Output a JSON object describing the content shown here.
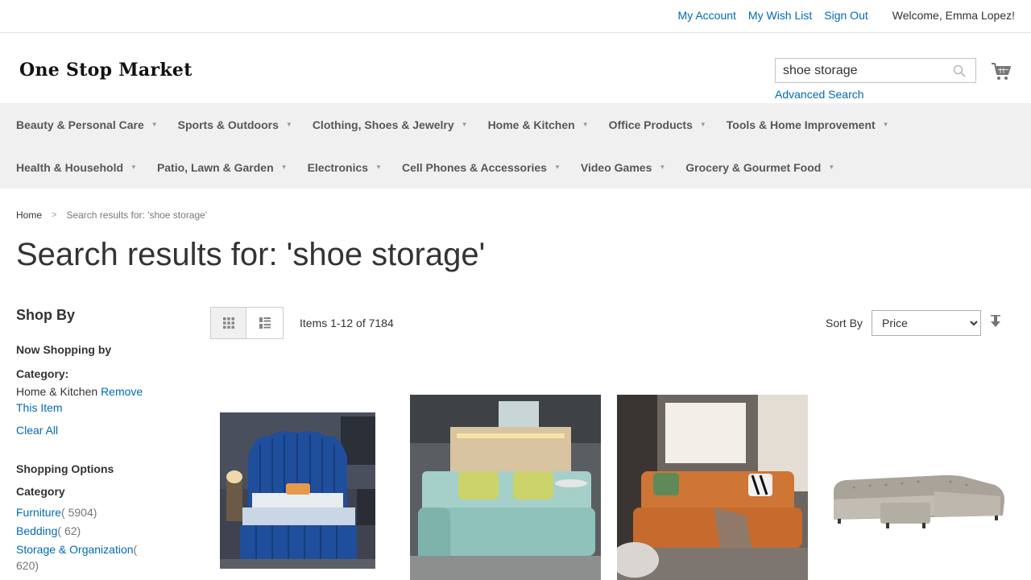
{
  "top_links": {
    "my_account": "My Account",
    "wish_list": "My Wish List",
    "sign_out": "Sign Out",
    "welcome": "Welcome, Emma Lopez!"
  },
  "header": {
    "logo_text": "One Stop Market",
    "search_value": "shoe storage",
    "advanced_search": "Advanced Search"
  },
  "nav": {
    "row1": [
      "Beauty & Personal Care",
      "Sports & Outdoors",
      "Clothing, Shoes & Jewelry",
      "Home & Kitchen",
      "Office Products",
      "Tools & Home Improvement"
    ],
    "row2": [
      "Health & Household",
      "Patio, Lawn & Garden",
      "Electronics",
      "Cell Phones & Accessories",
      "Video Games",
      "Grocery & Gourmet Food"
    ]
  },
  "breadcrumb": {
    "home": "Home",
    "current": "Search results for: 'shoe storage'"
  },
  "page_title": "Search results for: 'shoe storage'",
  "sidebar": {
    "shop_by": "Shop By",
    "now_shopping": "Now Shopping by",
    "filter_label": "Category:",
    "filter_value": "Home & Kitchen",
    "remove": "Remove This Item",
    "clear_all": "Clear All",
    "shopping_options": "Shopping Options",
    "category": "Category",
    "categories": [
      {
        "name": "Furniture",
        "count": "( 5904)"
      },
      {
        "name": "Bedding",
        "count": "( 62)"
      },
      {
        "name": "Storage & Organization",
        "count": "( 620)"
      }
    ]
  },
  "toolbar": {
    "items_count": "Items 1-12 of 7184",
    "sort_label": "Sort By",
    "sort_value": "Price"
  },
  "colors": {
    "link": "#006bb4",
    "nav_bg": "#f0f0f0"
  }
}
